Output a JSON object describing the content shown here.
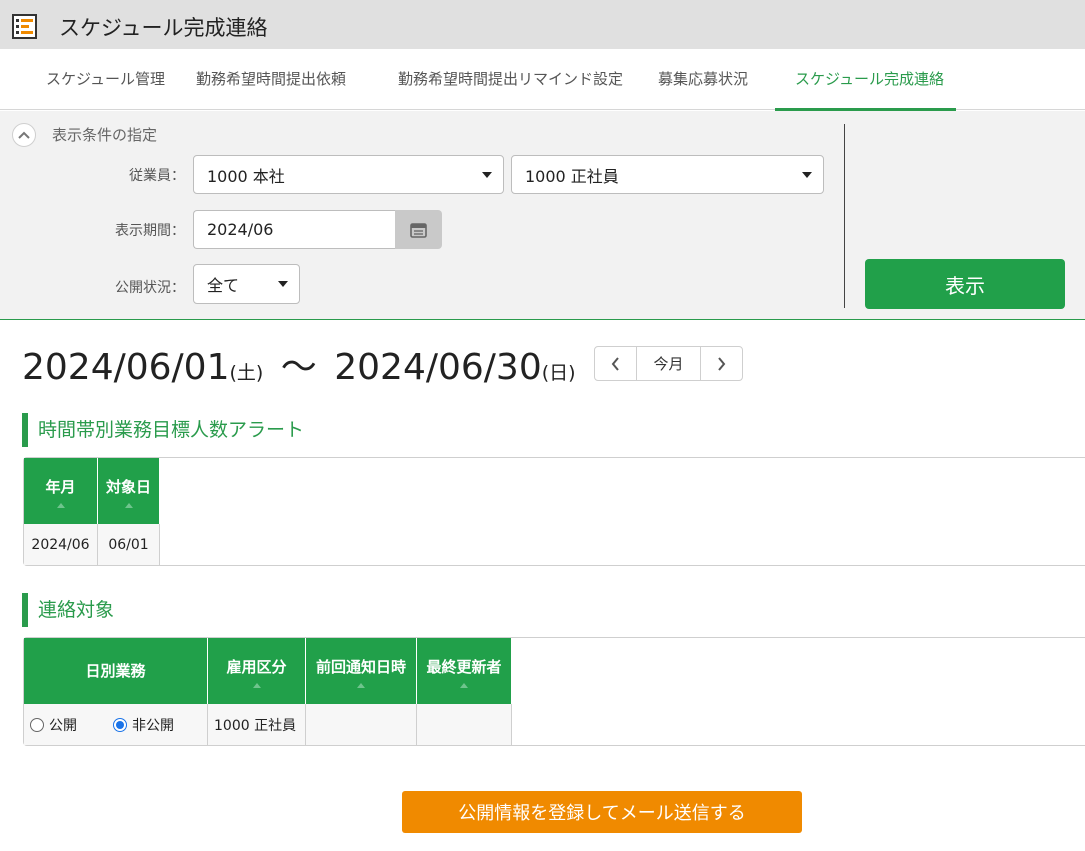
{
  "app": {
    "title": "スケジュール完成連絡",
    "accent": "#2a9b4c"
  },
  "tabs": [
    {
      "label": "スケジュール管理"
    },
    {
      "label": "勤務希望時間提出依頼"
    },
    {
      "label": "勤務希望時間提出リマインド設定"
    },
    {
      "label": "募集応募状況"
    },
    {
      "label": "スケジュール完成連絡",
      "active": true
    }
  ],
  "conditions": {
    "title": "表示条件の指定",
    "employee_label": "従業員：",
    "employee_store": "1000 本社",
    "employee_type": "1000 正社員",
    "period_label": "表示期間：",
    "period_value": "2024/06",
    "status_label": "公開状況：",
    "status_value": "全て",
    "show_button": "表示"
  },
  "period": {
    "start": "2024/06/01",
    "start_dow": "(土)",
    "separator": "～",
    "end": "2024/06/30",
    "end_dow": "(日)",
    "today_button": "今月"
  },
  "alert_section": {
    "title": "時間帯別業務目標人数アラート",
    "columns": [
      "年月",
      "対象日"
    ],
    "rows": [
      [
        "2024/06",
        "06/01"
      ]
    ]
  },
  "contact_section": {
    "title": "連絡対象",
    "columns": [
      "日別業務",
      "雇用区分",
      "前回通知日時",
      "最終更新者"
    ],
    "row": {
      "public_label": "公開",
      "private_label": "非公開",
      "selected": "非公開",
      "employment": "1000 正社員",
      "last_notified": "",
      "last_updated_by": ""
    }
  },
  "mail_button": "公開情報を登録してメール送信する"
}
